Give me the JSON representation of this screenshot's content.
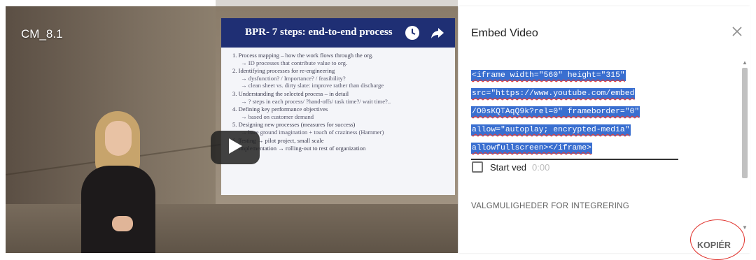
{
  "video": {
    "title": "CM_8.1",
    "slide": {
      "title": "BPR- 7 steps: end-to-end process",
      "items": [
        {
          "main": "1.  Process mapping – how the work flows through the org.",
          "sub": "→ ID processes that contribute value to org."
        },
        {
          "main": "2.  Identifying processes for re-engineering",
          "sub": "→ dysfunction? / Importance? / feasibility?"
        },
        {
          "main": "",
          "sub": "→ clean sheet vs. dirty slate: improve rather than discharge"
        },
        {
          "main": "3.  Understanding the selected process – in detail",
          "sub": "→ ? steps in each process/ ?hand-offs/ task time?/ wait time?.."
        },
        {
          "main": "4.  Defining key performance objectives",
          "sub": "→ based on customer demand"
        },
        {
          "main": "5.  Designing new processes (measures for success)",
          "sub": "→ bare ground imagination + touch of craziness (Hammer)"
        },
        {
          "main": "6.  Testing → pilot project, small scale",
          "sub": ""
        },
        {
          "main": "7.  Implementation → rolling-out to rest of organization",
          "sub": ""
        }
      ]
    },
    "icons": {
      "clock": "clock-icon",
      "share": "share-arrow-icon",
      "play": "play-icon"
    }
  },
  "panel": {
    "title": "Embed Video",
    "code_lines": [
      "<iframe width=\"560\" height=\"315\"",
      "src=\"https://www.youtube.com/embed",
      "/O0sKQTAqQ9k?rel=0\" frameborder=\"0\"",
      "allow=\"autoplay; encrypted-media\"",
      "allowfullscreen></iframe>"
    ],
    "start_label": "Start ved",
    "start_time": "0:00",
    "options_label": "VALGMULIGHEDER FOR INTEGRERING",
    "copy_label": "KOPIÉR"
  },
  "colors": {
    "highlight": "#3a6fd0",
    "annotation": "#e0302a",
    "slide_header": "#1f2f74"
  }
}
